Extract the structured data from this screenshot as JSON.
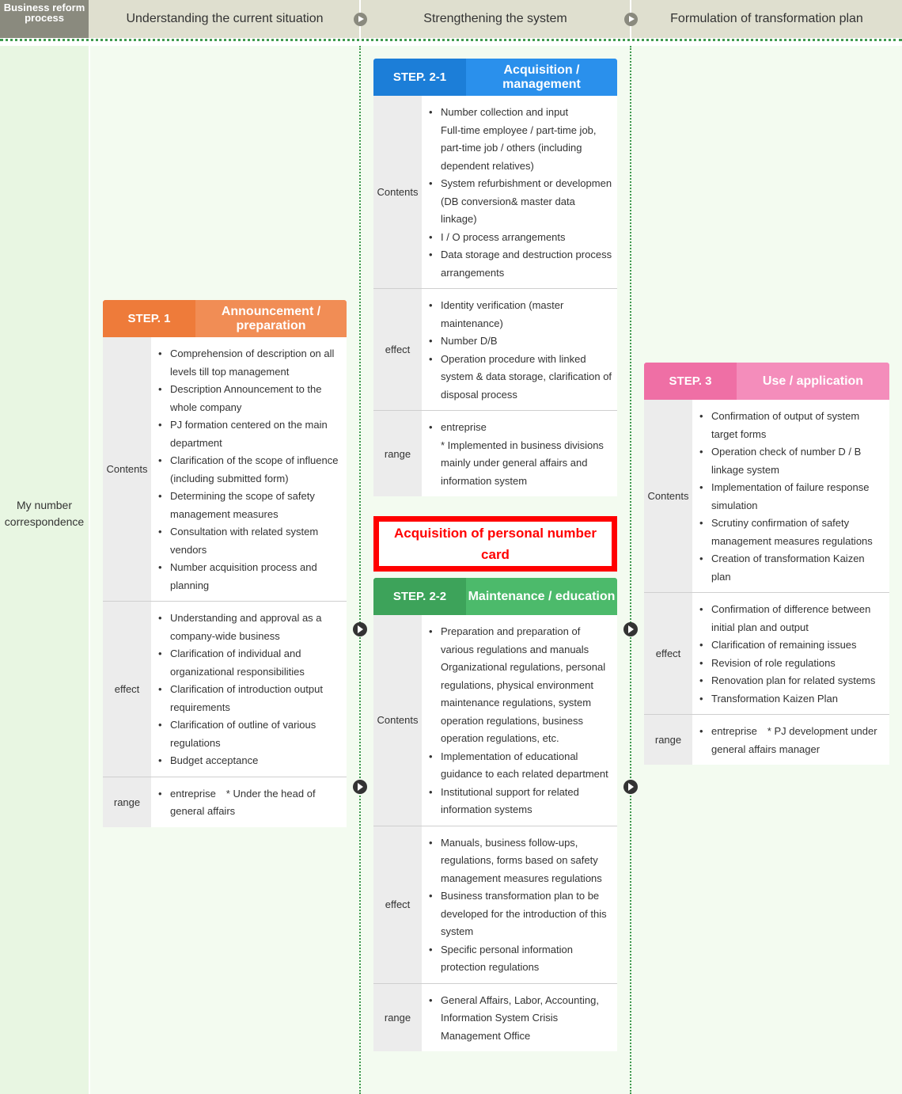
{
  "header": {
    "label": "Business reform process",
    "phases": [
      "Understanding the current situation",
      "Strengthening the system",
      "Formulation of transformation plan"
    ]
  },
  "row_label": "My number correspondence",
  "colors": {
    "step1_dark": "#ee7b3a",
    "step1_light": "#f18d55",
    "step21_dark": "#1c7ed8",
    "step21_light": "#2a90ec",
    "step22_dark": "#3da35a",
    "step22_light": "#4cba6b",
    "step3_dark": "#ef6fa5",
    "step3_light": "#f48dbb",
    "callout": "#ff0000"
  },
  "callout": {
    "text": "Acquisition of personal number card"
  },
  "steps": {
    "step1": {
      "id": "STEP. 1",
      "title": "Announcement / preparation",
      "sections": [
        {
          "label": "Contents",
          "items": [
            "Comprehension of description on all levels till top management",
            "Description Announcement to the whole company",
            "PJ formation centered on the main department",
            "Clarification of the scope of influence (including submitted form)",
            "Determining the scope of safety management measures",
            "Consultation with related system vendors",
            "Number acquisition process and planning"
          ]
        },
        {
          "label": "effect",
          "items": [
            "Understanding and approval as a company-wide business",
            "Clarification of individual and organizational responsibilities",
            "Clarification of introduction output requirements",
            "Clarification of outline of various regulations",
            "Budget acceptance"
          ]
        },
        {
          "label": "range",
          "items": [
            "entreprise　* Under the head of general affairs"
          ]
        }
      ]
    },
    "step21": {
      "id": "STEP. 2-1",
      "title": "Acquisition / management",
      "sections": [
        {
          "label": "Contents",
          "items": [
            "Number collection and input\nFull-time employee / part-time job, part-time job / others (including dependent relatives)",
            "System refurbishment or developmen\n(DB conversion& master data linkage)",
            "I / O process arrangements",
            "Data storage and destruction process arrangements"
          ]
        },
        {
          "label": "effect",
          "items": [
            "Identity verification (master maintenance)",
            "Number D/B",
            "Operation procedure with linked system & data storage, clarification of disposal process"
          ]
        },
        {
          "label": "range",
          "items": [
            "entreprise\n* Implemented in business divisions mainly under general affairs and information system"
          ]
        }
      ]
    },
    "step22": {
      "id": "STEP. 2-2",
      "title": "Maintenance / education",
      "sections": [
        {
          "label": "Contents",
          "items": [
            "Preparation and preparation of various regulations and manuals\nOrganizational regulations, personal regulations, physical environment maintenance regulations, system operation regulations, business operation regulations, etc.",
            "Implementation of educational guidance to each related department",
            "Institutional support for related information systems"
          ]
        },
        {
          "label": "effect",
          "items": [
            "Manuals, business follow-ups, regulations, forms based on safety management measures regulations",
            "Business transformation plan to be developed for the introduction of this system",
            "Specific personal information protection regulations"
          ]
        },
        {
          "label": "range",
          "items": [
            "General Affairs, Labor, Accounting, Information System Crisis Management Office"
          ]
        }
      ]
    },
    "step3": {
      "id": "STEP. 3",
      "title": "Use / application",
      "sections": [
        {
          "label": "Contents",
          "items": [
            "Confirmation of output of system target forms",
            "Operation check of number D / B linkage system",
            "Implementation of failure response simulation",
            "Scrutiny confirmation of safety management measures regulations",
            "Creation of transformation Kaizen plan"
          ]
        },
        {
          "label": "effect",
          "items": [
            "Confirmation of difference between initial plan and output",
            "Clarification of remaining issues",
            "Revision of role regulations",
            "Renovation plan for related systems",
            "Transformation Kaizen Plan"
          ]
        },
        {
          "label": "range",
          "items": [
            "entreprise　* PJ development under general affairs manager"
          ]
        }
      ]
    }
  }
}
